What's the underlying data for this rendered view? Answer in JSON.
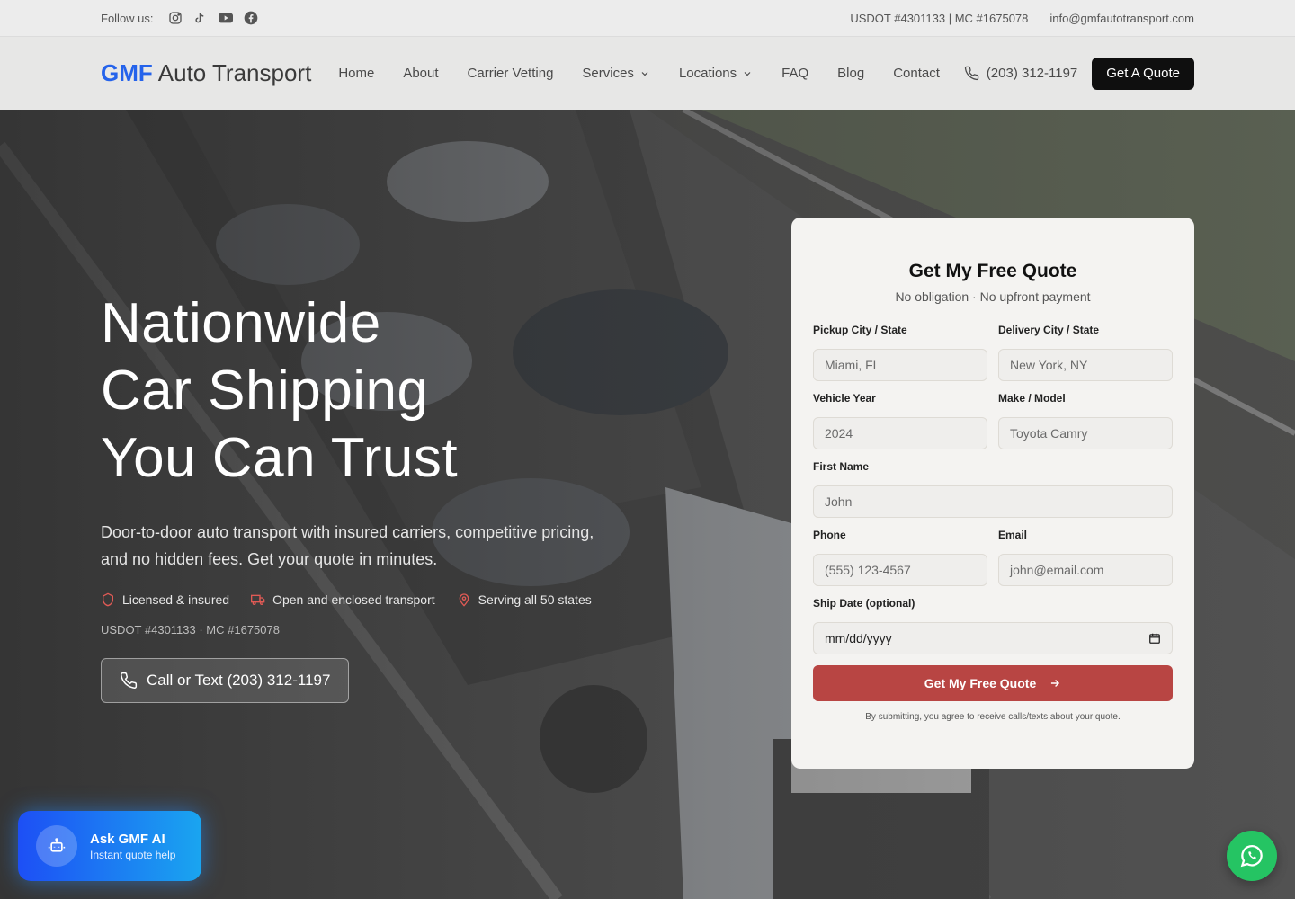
{
  "topbar": {
    "follow_label": "Follow us:",
    "social_icons": [
      "instagram-icon",
      "tiktok-icon",
      "youtube-icon",
      "facebook-icon"
    ],
    "usdot": "USDOT #4301133 | MC #1675078",
    "email": "info@gmfautotransport.com"
  },
  "nav": {
    "brand": "GMF",
    "brand_rest": "Auto Transport",
    "items": [
      {
        "label": "Home"
      },
      {
        "label": "About"
      },
      {
        "label": "Carrier Vetting"
      },
      {
        "label": "Services",
        "dropdown": true
      },
      {
        "label": "Locations",
        "dropdown": true
      },
      {
        "label": "FAQ"
      },
      {
        "label": "Blog"
      },
      {
        "label": "Contact"
      }
    ],
    "phone": "(203) 312-1197",
    "cta": "Get A Quote"
  },
  "hero": {
    "title_lines": [
      "Nationwide",
      "Car Shipping",
      "You Can Trust"
    ],
    "subtitle": "Door-to-door auto transport with insured carriers, competitive pricing, and no hidden fees. Get your quote in minutes.",
    "badges": [
      {
        "icon": "shield-icon",
        "label": "Licensed & insured"
      },
      {
        "icon": "truck-icon",
        "label": "Open and enclosed transport"
      },
      {
        "icon": "map-pin-icon",
        "label": "Serving all 50 states"
      }
    ],
    "usdot": "USDOT #4301133 · MC #1675078",
    "call_button": "Call or Text (203) 312-1197"
  },
  "form": {
    "title": "Get My Free Quote",
    "subtitle": "No obligation · No upfront payment",
    "fields": {
      "pickup": {
        "label": "Pickup City / State",
        "placeholder": "Miami, FL"
      },
      "delivery": {
        "label": "Delivery City / State",
        "placeholder": "New York, NY"
      },
      "year": {
        "label": "Vehicle Year",
        "placeholder": "2024"
      },
      "make": {
        "label": "Make / Model",
        "placeholder": "Toyota Camry"
      },
      "first_name": {
        "label": "First Name",
        "placeholder": "John"
      },
      "phone": {
        "label": "Phone",
        "placeholder": "(555) 123-4567"
      },
      "email": {
        "label": "Email",
        "placeholder": "john@email.com"
      },
      "ship_date": {
        "label": "Ship Date (optional)",
        "value": "mm/dd/yyyy"
      }
    },
    "submit": "Get My Free Quote",
    "terms": "By submitting, you agree to receive calls/texts about your quote."
  },
  "ai_widget": {
    "title": "Ask GMF AI",
    "subtitle": "Instant quote help"
  },
  "colors": {
    "brand_blue": "#2563eb",
    "submit_red": "#b84543",
    "whatsapp_green": "#25c463",
    "cta_black": "#0f0f0f"
  }
}
